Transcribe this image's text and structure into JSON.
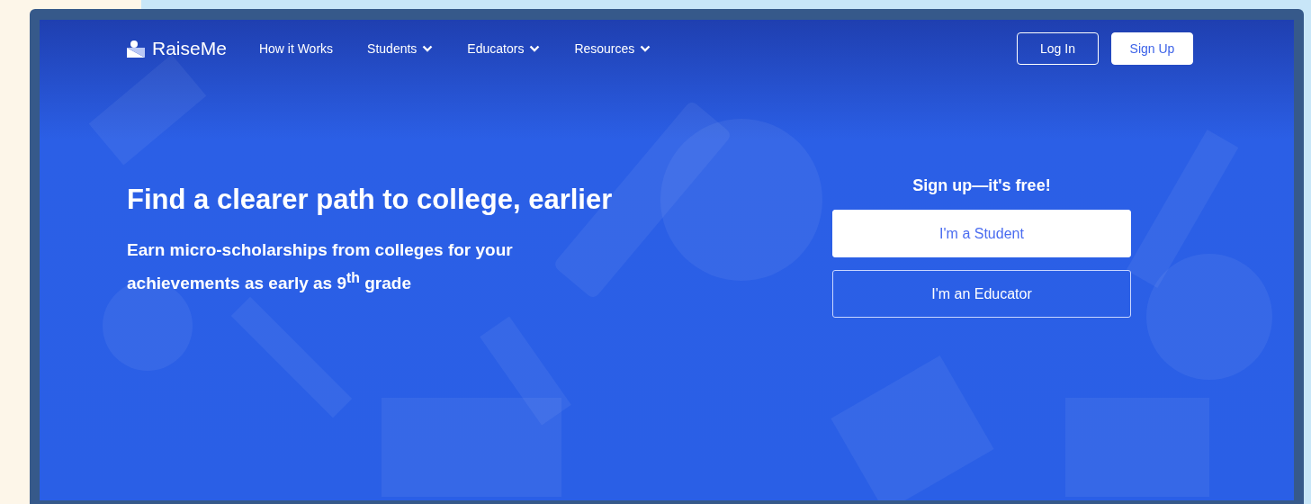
{
  "nav": {
    "brand": "RaiseMe",
    "items": [
      {
        "label": "How it Works",
        "has_menu": false
      },
      {
        "label": "Students",
        "has_menu": true
      },
      {
        "label": "Educators",
        "has_menu": true
      },
      {
        "label": "Resources",
        "has_menu": true
      }
    ],
    "buttons": [
      {
        "label": "Log In",
        "kind": "outline"
      },
      {
        "label": "Sign Up",
        "kind": "solid"
      }
    ]
  },
  "hero": {
    "headline": "Find a clearer path to college, earlier",
    "subtitle": "Earn micro-scholarships from colleges for your achievements as early as 9$^{th}$ grade"
  },
  "signup": {
    "title": "Sign up—it's free!",
    "buttons": [
      {
        "label": "I'm a Student",
        "kind": "solid"
      },
      {
        "label": "I'm an Educator",
        "kind": "outline"
      }
    ]
  }
}
